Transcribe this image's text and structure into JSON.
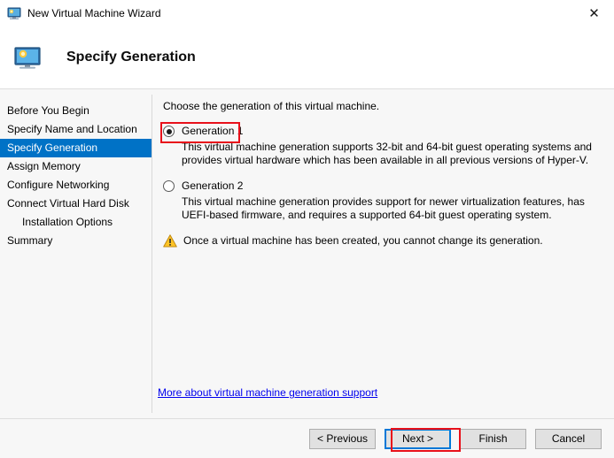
{
  "window": {
    "title": "New Virtual Machine Wizard",
    "titlebar_icon": "virtual-machine-monitor-icon",
    "close_label": "✕"
  },
  "header": {
    "title": "Specify Generation",
    "icon": "virtual-machine-monitor-icon"
  },
  "sidebar": {
    "items": [
      {
        "label": "Before You Begin",
        "selected": false,
        "indented": false
      },
      {
        "label": "Specify Name and Location",
        "selected": false,
        "indented": false
      },
      {
        "label": "Specify Generation",
        "selected": true,
        "indented": false
      },
      {
        "label": "Assign Memory",
        "selected": false,
        "indented": false
      },
      {
        "label": "Configure Networking",
        "selected": false,
        "indented": false
      },
      {
        "label": "Connect Virtual Hard Disk",
        "selected": false,
        "indented": false
      },
      {
        "label": "Installation Options",
        "selected": false,
        "indented": true
      },
      {
        "label": "Summary",
        "selected": false,
        "indented": false
      }
    ]
  },
  "content": {
    "intro": "Choose the generation of this virtual machine.",
    "options": [
      {
        "label": "Generation 1",
        "checked": true,
        "description": "This virtual machine generation supports 32-bit and 64-bit guest operating systems and provides virtual hardware which has been available in all previous versions of Hyper-V."
      },
      {
        "label": "Generation 2",
        "checked": false,
        "description": "This virtual machine generation provides support for newer virtualization features, has UEFI-based firmware, and requires a supported 64-bit guest operating system."
      }
    ],
    "warning": {
      "icon": "warning-triangle-icon",
      "text": "Once a virtual machine has been created, you cannot change its generation."
    },
    "more_link": "More about virtual machine generation support"
  },
  "footer": {
    "buttons": [
      {
        "label": "< Previous",
        "default": false
      },
      {
        "label": "Next >",
        "default": true
      },
      {
        "label": "Finish",
        "default": false
      },
      {
        "label": "Cancel",
        "default": false
      }
    ]
  },
  "annotations": [
    {
      "name": "generation-1-highlight",
      "color": "#e8101a"
    },
    {
      "name": "next-button-highlight",
      "color": "#e8101a"
    }
  ],
  "colors": {
    "selected_nav": "#0072c6",
    "link": "#0000ee",
    "annotation": "#e8101a",
    "default_button_border": "#0078d7",
    "body_background": "#f7f7f7"
  }
}
